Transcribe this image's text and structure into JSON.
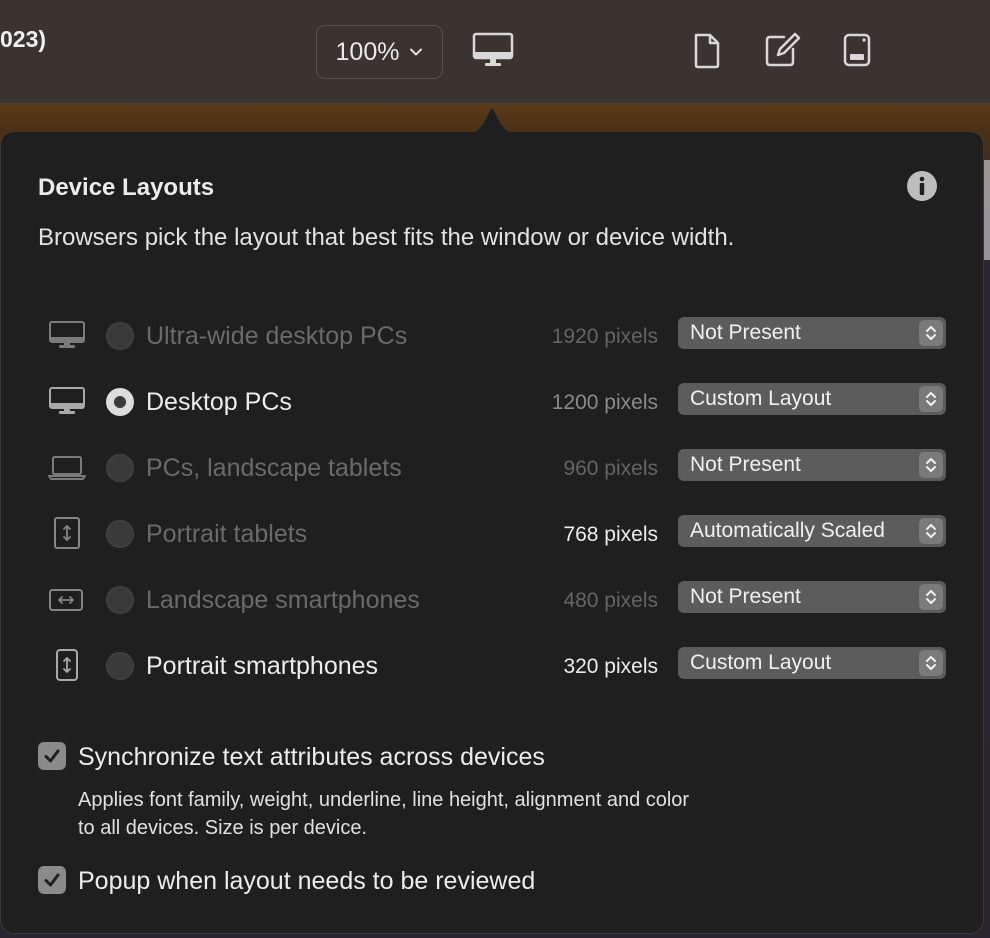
{
  "toolbar": {
    "title_fragment": "023)",
    "zoom_label": "100%",
    "icons": [
      "chevron-down-icon",
      "desktop-monitor-icon",
      "document-icon",
      "compose-icon",
      "device-preview-icon"
    ]
  },
  "popover": {
    "title": "Device Layouts",
    "subtitle": "Browsers pick the layout that best fits the window or device width.",
    "info_icon": "info-icon",
    "rows": [
      {
        "icon": "desktop-monitor-icon",
        "label": "Ultra-wide desktop PCs",
        "pixels": "1920 pixels",
        "layout": "Not Present",
        "selected": false,
        "active": false
      },
      {
        "icon": "desktop-monitor-icon",
        "label": "Desktop PCs",
        "pixels": "1200 pixels",
        "layout": "Custom Layout",
        "selected": true,
        "active": true
      },
      {
        "icon": "laptop-icon",
        "label": "PCs, landscape tablets",
        "pixels": "960 pixels",
        "layout": "Not Present",
        "selected": false,
        "active": false
      },
      {
        "icon": "portrait-tablet-icon",
        "label": "Portrait tablets",
        "pixels": "768 pixels",
        "layout": "Automatically Scaled",
        "selected": false,
        "active": false
      },
      {
        "icon": "landscape-phone-icon",
        "label": "Landscape smartphones",
        "pixels": "480 pixels",
        "layout": "Not Present",
        "selected": false,
        "active": false
      },
      {
        "icon": "portrait-phone-icon",
        "label": "Portrait smartphones",
        "pixels": "320 pixels",
        "layout": "Custom Layout",
        "selected": false,
        "active": true
      }
    ],
    "sync_checkbox": {
      "label": "Synchronize text attributes across devices",
      "checked": true,
      "desc_line1": "Applies font family, weight, underline, line height, alignment and color",
      "desc_line2": "to all devices. Size is per device."
    },
    "popup_checkbox": {
      "label": "Popup when layout needs to be reviewed",
      "checked": true
    }
  },
  "colors": {
    "popover_bg": "#1f1f1f",
    "select_bg": "#5c5c5c",
    "dim_text": "#6a6a6a",
    "bright_text": "#ececec"
  }
}
